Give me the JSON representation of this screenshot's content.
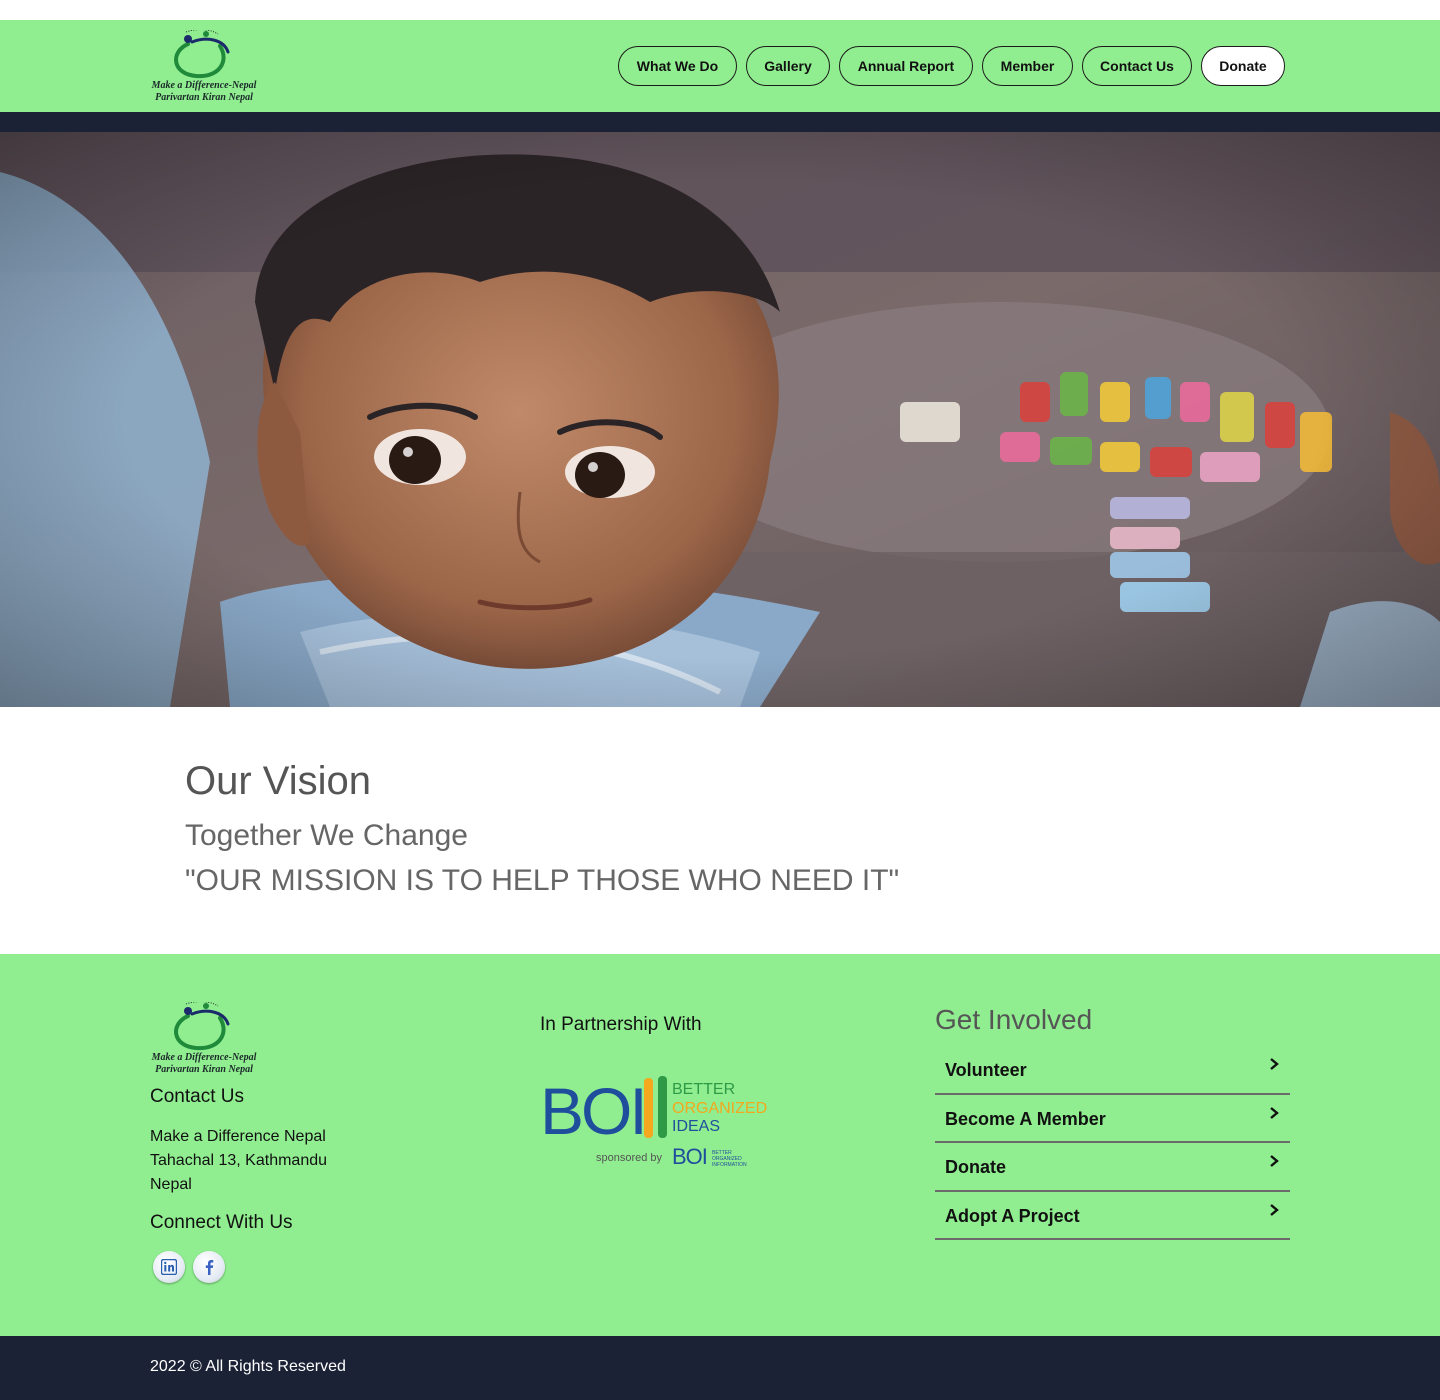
{
  "brand": {
    "logo_line1": "Make a Difference-Nepal",
    "logo_line2": "Parivartan Kiran Nepal",
    "logo_icon": "circle-figure-logo-icon",
    "header_color": "#90ee90",
    "dark_color": "#1c2235"
  },
  "nav": {
    "items": [
      {
        "label": "What We Do"
      },
      {
        "label": "Gallery"
      },
      {
        "label": "Annual Report"
      },
      {
        "label": "Member"
      },
      {
        "label": "Contact Us"
      },
      {
        "label": "Donate"
      }
    ]
  },
  "hero": {
    "image": "child-looking-over-shoulder-photo"
  },
  "vision": {
    "title": "Our Vision",
    "subtitle": "Together We Change",
    "mission": "\"OUR MISSION IS TO HELP THOSE WHO NEED IT\""
  },
  "footer": {
    "contact_heading": "Contact Us",
    "address": [
      "Make a Difference Nepal",
      "Tahachal 13, Kathmandu",
      "Nepal"
    ],
    "connect_heading": "Connect With Us",
    "social": [
      {
        "icon": "linkedin-icon"
      },
      {
        "icon": "facebook-icon"
      }
    ],
    "partner_heading": "In Partnership With",
    "partner_logo": {
      "big": "BOI",
      "line1": "BETTER",
      "line2": "ORGANIZED",
      "line3": "IDEAS",
      "sponsored": "sponsored by",
      "small": "BOI",
      "small_l1": "BETTER",
      "small_l2": "ORGANIZED",
      "small_l3": "INFORMATION"
    },
    "get_involved_heading": "Get Involved",
    "get_involved": [
      {
        "label": "Volunteer"
      },
      {
        "label": "Become A Member"
      },
      {
        "label": "Donate"
      },
      {
        "label": "Adopt A Project"
      }
    ]
  },
  "copyright": "2022 © All Rights Reserved"
}
